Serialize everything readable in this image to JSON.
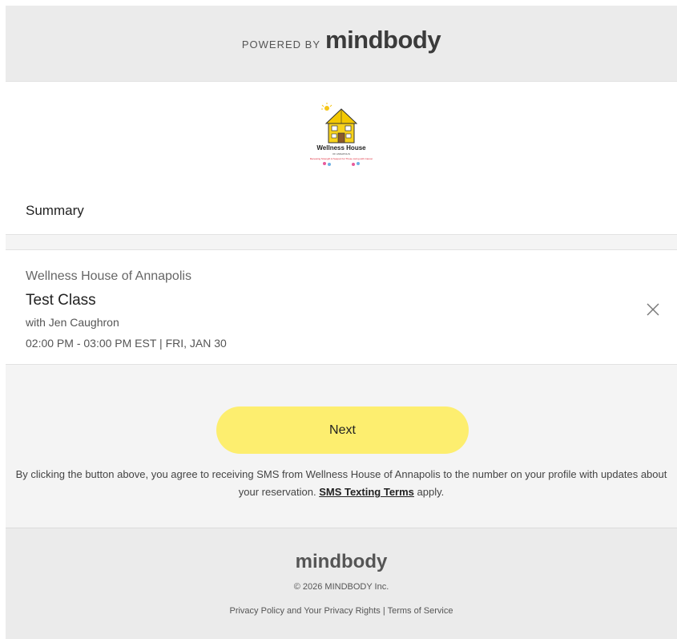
{
  "header": {
    "powered_by": "POWERED BY",
    "brand": "mindbody"
  },
  "studio_logo": {
    "name": "Wellness House",
    "sub": "OF ANNAPOLIS",
    "tagline": "Renewing Strength & Support for Those Living with Cancer"
  },
  "summary": {
    "title": "Summary"
  },
  "booking": {
    "studio": "Wellness House of Annapolis",
    "class_name": "Test Class",
    "instructor": "with Jen Caughron",
    "time": "02:00 PM - 03:00 PM EST | FRI, JAN 30",
    "remove_icon": "close-icon"
  },
  "actions": {
    "next_label": "Next"
  },
  "consent": {
    "text_before": "By clicking the button above, you agree to receiving SMS from Wellness House of Annapolis to the number on your profile with updates about your reservation. ",
    "link_text": "SMS Texting Terms",
    "text_after": " apply."
  },
  "footer": {
    "brand": "mindbody",
    "copyright": "© 2026 MINDBODY Inc.",
    "privacy_link": "Privacy Policy and Your Privacy Rights",
    "separator": "|",
    "terms_link": "Terms of Service"
  },
  "colors": {
    "next_button": "#fdee6f",
    "page_bg": "#f4f4f4",
    "band_bg": "#ebebeb"
  }
}
